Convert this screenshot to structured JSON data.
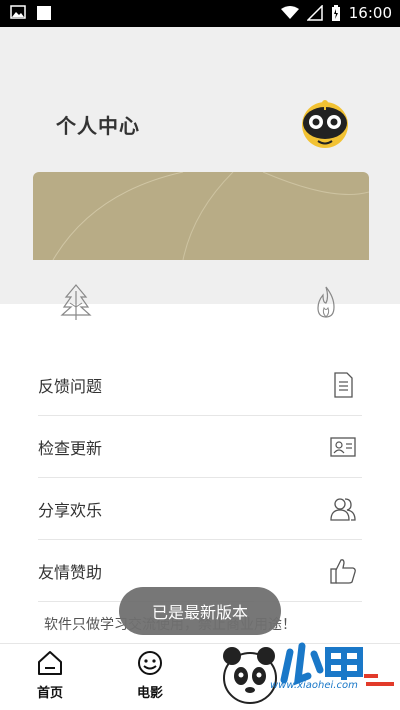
{
  "status_bar": {
    "time": "16:00"
  },
  "header": {
    "title": "个人中心"
  },
  "menu": {
    "items": [
      {
        "label": "反馈问题",
        "icon": "document-icon"
      },
      {
        "label": "检查更新",
        "icon": "id-card-icon"
      },
      {
        "label": "分享欢乐",
        "icon": "users-icon"
      },
      {
        "label": "友情赞助",
        "icon": "thumbs-up-icon"
      }
    ]
  },
  "footer_note": "软件只做学习交流使用，禁止商业用途！",
  "tabs": [
    {
      "label": "首页",
      "icon": "home-icon"
    },
    {
      "label": "电影",
      "icon": "smile-icon"
    }
  ],
  "toast": "已是最新版本",
  "watermark": {
    "text": "www.xiaohei.com",
    "brand": "小黑游戏"
  },
  "colors": {
    "banner": "#b8ac86",
    "header_bg": "#efefef",
    "toast_bg": "#707070"
  }
}
